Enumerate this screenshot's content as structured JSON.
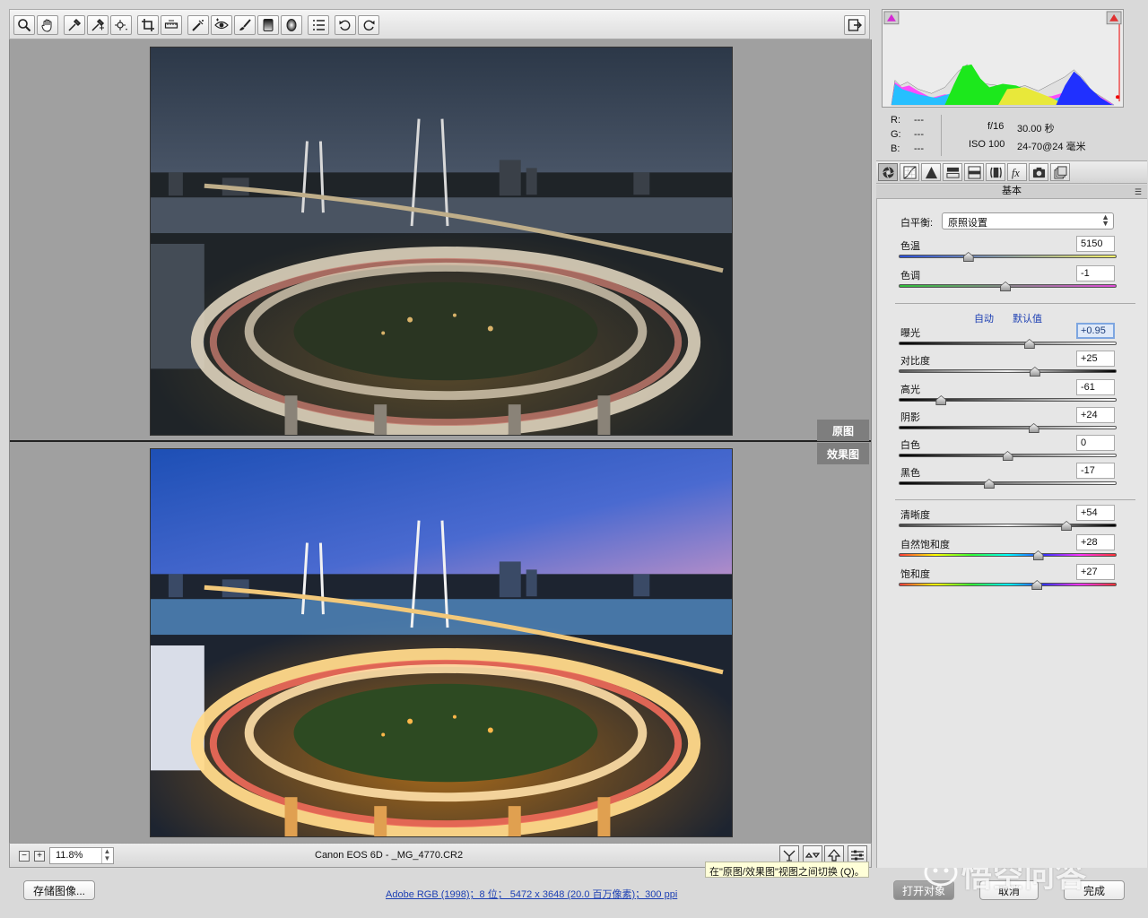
{
  "toolbar": {
    "tools": [
      "zoom-icon",
      "hand-icon",
      "white-balance-icon",
      "color-sampler-icon",
      "targeted-adjustment-icon",
      "crop-icon",
      "straighten-icon",
      "spot-removal-icon",
      "red-eye-icon",
      "adjustment-brush-icon",
      "graduated-filter-icon",
      "radial-filter-icon",
      "preferences-icon",
      "rotate-left-icon",
      "rotate-right-icon"
    ],
    "export_icon": "full-screen-icon"
  },
  "preview": {
    "before_label": "原图",
    "after_label": "效果图"
  },
  "statusbar": {
    "zoom": "11.8%",
    "filename": "Canon EOS 6D -  _MG_4770.CR2",
    "tooltip": "在\"原图/效果图\"视图之间切换 (Q)。"
  },
  "footer": {
    "save_label": "存储图像...",
    "workflow": "Adobe RGB (1998)；8 位； 5472 x 3648 (20.0 百万像素)；300 ppi",
    "open_label": "打开对象",
    "cancel_label": "取消",
    "done_label": "完成",
    "watermark": "悟空问答"
  },
  "info": {
    "r_label": "R:",
    "r_value": "---",
    "g_label": "G:",
    "g_value": "---",
    "b_label": "B:",
    "b_value": "---",
    "aperture": "f/16",
    "shutter": "30.00 秒",
    "iso": "ISO 100",
    "lens": "24-70@24 毫米"
  },
  "panel": {
    "title": "基本",
    "wb_label": "白平衡:",
    "wb_value": "原照设置",
    "auto_label": "自动",
    "default_label": "默认值",
    "sliders": [
      {
        "label": "色温",
        "value": "5150",
        "level": 0.32
      },
      {
        "label": "色调",
        "value": "-1",
        "level": 0.49
      },
      {
        "label": "曝光",
        "value": "+0.95",
        "level": 0.6
      },
      {
        "label": "对比度",
        "value": "+25",
        "level": 0.625
      },
      {
        "label": "高光",
        "value": "-61",
        "level": 0.195
      },
      {
        "label": "阴影",
        "value": "+24",
        "level": 0.62
      },
      {
        "label": "白色",
        "value": "0",
        "level": 0.5
      },
      {
        "label": "黑色",
        "value": "-17",
        "level": 0.415
      },
      {
        "label": "清晰度",
        "value": "+54",
        "level": 0.77
      },
      {
        "label": "自然饱和度",
        "value": "+28",
        "level": 0.64
      },
      {
        "label": "饱和度",
        "value": "+27",
        "level": 0.635
      }
    ]
  }
}
